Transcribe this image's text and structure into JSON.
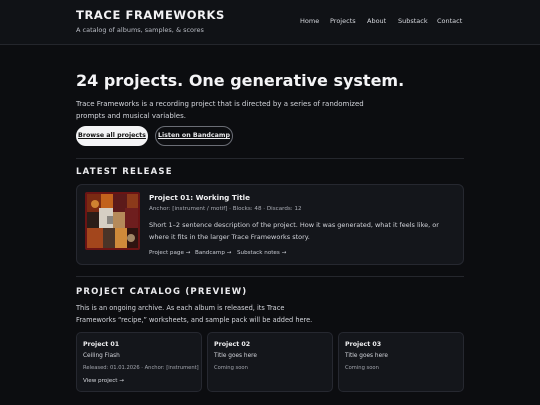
{
  "header": {
    "brand": "TRACE FRAMEWORKS",
    "tagline": "A catalog of albums, samples, & scores",
    "nav": [
      "Home",
      "Projects",
      "About",
      "Substack",
      "Contact"
    ]
  },
  "hero": {
    "title": "24 projects. One generative system.",
    "description": "Trace Frameworks is a recording project that is directed by a series of randomized prompts and musical variables.",
    "primary_button": "Browse all projects",
    "secondary_button": "Listen on Bandcamp"
  },
  "latest_release": {
    "section_title": "LATEST RELEASE",
    "title": "Project 01: Working Title",
    "meta": "Anchor: [instrument / motif] · Blocks: 48 · Discards: 12",
    "description": "Short 1–2 sentence description of the project. How it was generated, what it feels like, or where it fits in the larger Trace Frameworks story.",
    "links": [
      "Project page →",
      "Bandcamp →",
      "Substack notes →"
    ]
  },
  "catalog": {
    "section_title": "PROJECT CATALOG (PREVIEW)",
    "description": "This is an ongoing archive. As each album is released, its Trace Frameworks “recipe,” worksheets, and sample pack will be added here.",
    "cards": [
      {
        "name": "Project 01",
        "subtitle": "Ceiling Flash",
        "meta": "Released: 01.01.2026 · Anchor: [instrument]",
        "link": "View project →"
      },
      {
        "name": "Project 02",
        "subtitle": "Title goes here",
        "meta": "Coming soon"
      },
      {
        "name": "Project 03",
        "subtitle": "Title goes here",
        "meta": "Coming soon"
      }
    ]
  },
  "colors": {
    "background": "#0c0d10",
    "card": "#14161b",
    "primary_button": "#f4f4f6",
    "cover_border": "#6b1414"
  }
}
